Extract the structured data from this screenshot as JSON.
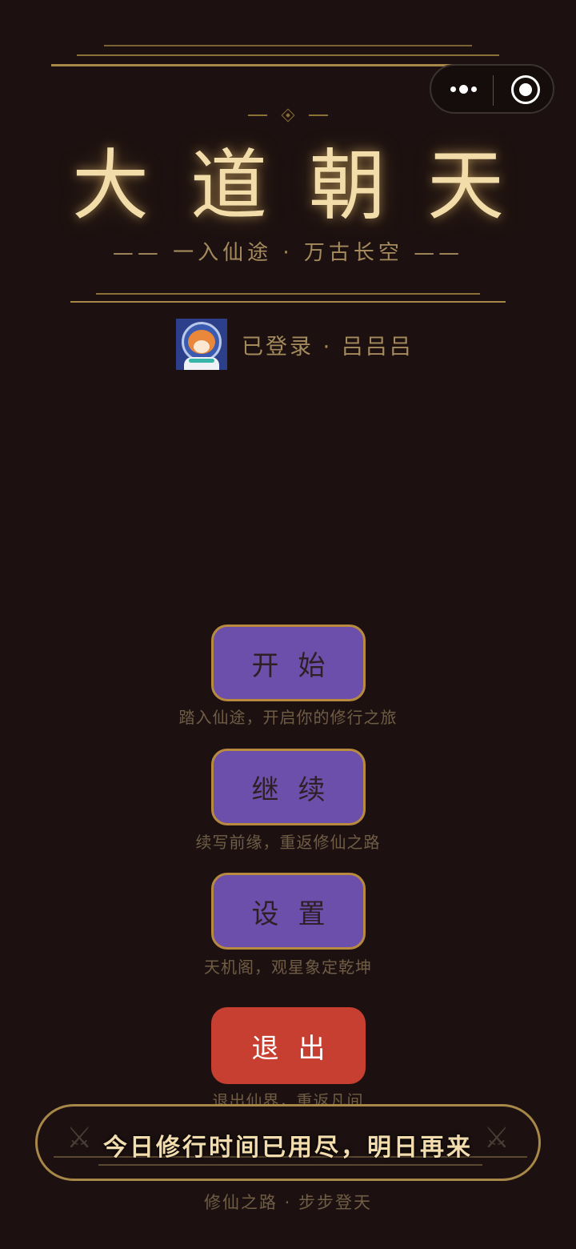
{
  "title": "大道朝天",
  "subtitle": "—— 一入仙途 · 万古长空 ——",
  "login": {
    "text": "已登录 · 吕吕吕",
    "avatar_icon": "shiba-astronaut-avatar"
  },
  "menu": {
    "start": {
      "label": "开始",
      "desc": "踏入仙途，开启你的修行之旅"
    },
    "continue": {
      "label": "继续",
      "desc": "续写前缘，重返修仙之路"
    },
    "settings": {
      "label": "设置",
      "desc": "天机阁，观星象定乾坤"
    },
    "exit": {
      "label": "退出",
      "desc": "退出仙界，重返凡间"
    }
  },
  "banner": {
    "text": "今日修行时间已用尽，明日再来",
    "icon_left": "crossed-swords-icon",
    "icon_right": "crossed-swords-icon"
  },
  "footer": "修仙之路 · 步步登天",
  "colors": {
    "background": "#1c1110",
    "gold": "#a88848",
    "title": "#f1dcaa",
    "button_purple": "#6b4fab",
    "button_red": "#c63f30"
  }
}
